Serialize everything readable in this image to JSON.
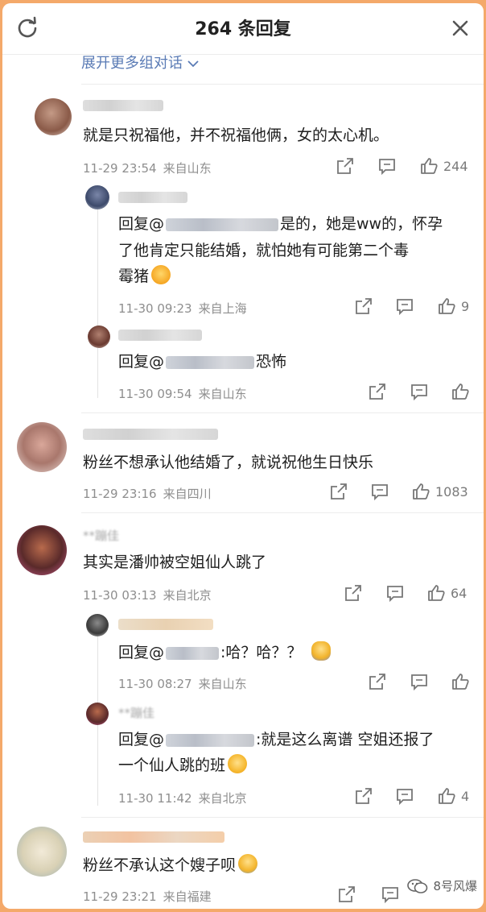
{
  "header": {
    "title": "264 条回复"
  },
  "expand_label": "展开更多组对话",
  "comments": [
    {
      "text": "就是只祝福他，并不祝福他俩，女的太心机。",
      "time": "11-29 23:54",
      "location": "来自山东",
      "likes": "244"
    },
    {
      "reply_prefix": "回复",
      "text_a": "是的，她是ww的，怀孕",
      "text_b": "了他肯定只能结婚，就怕她有可能第二个毒",
      "text_c": "霉猪",
      "time": "11-30 09:23",
      "location": "来自上海",
      "likes": "9"
    },
    {
      "reply_prefix": "回复",
      "text": "恐怖",
      "time": "11-30 09:54",
      "location": "来自山东",
      "likes": ""
    },
    {
      "text": "粉丝不想承认他结婚了，就说祝他生日快乐",
      "time": "11-29 23:16",
      "location": "来自四川",
      "likes": "1083"
    },
    {
      "name": "**蹦佳",
      "text": "其实是潘帅被空姐仙人跳了",
      "time": "11-30 03:13",
      "location": "来自北京",
      "likes": "64"
    },
    {
      "reply_prefix": "回复",
      "text": ":哈？哈？？",
      "time": "11-30 08:27",
      "location": "来自山东",
      "likes": ""
    },
    {
      "name": "**蹦佳",
      "reply_prefix": "回复",
      "text_a": ":就是这么离谱 空姐还报了",
      "text_b": "一个仙人跳的班",
      "time": "11-30 11:42",
      "location": "来自北京",
      "likes": "4"
    },
    {
      "text": "粉丝不承认这个嫂子呗",
      "time": "11-29 23:21",
      "location": "来自福建",
      "likes": ""
    }
  ],
  "watermark": "8号风爆",
  "icons": [
    "refresh-icon",
    "close-icon",
    "share-icon",
    "comment-icon",
    "like-icon",
    "chevron-down-icon",
    "wechat-icon"
  ],
  "colors": {
    "link": "#5a7bb5",
    "meta": "#8e8e8e",
    "frame_bg": "#f4a96a"
  }
}
